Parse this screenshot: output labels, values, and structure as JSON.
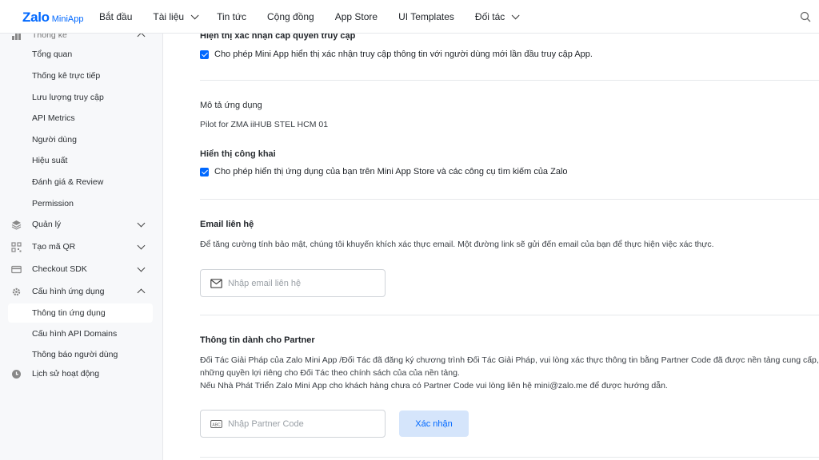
{
  "header": {
    "logo_main": "Zalo",
    "logo_sub": "MiniApp",
    "nav": [
      {
        "label": "Bắt đầu",
        "has_menu": false
      },
      {
        "label": "Tài liệu",
        "has_menu": true
      },
      {
        "label": "Tin tức",
        "has_menu": false
      },
      {
        "label": "Cộng đồng",
        "has_menu": false
      },
      {
        "label": "App Store",
        "has_menu": false
      },
      {
        "label": "UI Templates",
        "has_menu": false
      },
      {
        "label": "Đối tác",
        "has_menu": true
      }
    ],
    "search_icon": "search-icon"
  },
  "sidebar": {
    "cut_group": "Thống kê",
    "stats_items": [
      "Tổng quan",
      "Thống kê trực tiếp",
      "Lưu lượng truy cập",
      "API Metrics",
      "Người dùng",
      "Hiệu suất",
      "Đánh giá & Review",
      "Permission"
    ],
    "groups": [
      {
        "label": "Quản lý",
        "icon": "layers-icon"
      },
      {
        "label": "Tạo mã QR",
        "icon": "qr-code-icon"
      },
      {
        "label": "Checkout SDK",
        "icon": "credit-card-icon"
      },
      {
        "label": "Cấu hình ứng dụng",
        "icon": "gear-icon"
      }
    ],
    "config_items": [
      "Thông tin ứng dụng",
      "Cấu hình API Domains",
      "Thông báo người dùng"
    ],
    "active_item": "Thông tin ứng dụng",
    "history": {
      "label": "Lịch sử hoạt động",
      "icon": "clock-icon"
    }
  },
  "main": {
    "access_confirm": {
      "title": "Hiện thị xác nhận cấp quyền truy cập",
      "checkbox_label": "Cho phép Mini App hiển thị xác nhận truy cập thông tin với người dùng mới lần đầu truy cập App.",
      "checked": true
    },
    "description": {
      "label": "Mô tả ứng dụng",
      "value": "Pilot for ZMA iiHUB STEL HCM 01"
    },
    "public_display": {
      "label": "Hiển thị công khai",
      "checkbox_label": "Cho phép hiển thị ứng dụng của bạn trên Mini App Store và các công cụ tìm kiếm của Zalo",
      "checked": true
    },
    "email": {
      "title": "Email liên hệ",
      "description": "Để tăng cường tính bảo mật, chúng tôi khuyến khích xác thực email. Một đường link sẽ gửi đến email của bạn để thực hiện việc xác thực.",
      "placeholder": "Nhập email liên hệ",
      "icon": "mail-icon"
    },
    "partner": {
      "title": "Thông tin dành cho Partner",
      "line1": "Đối Tác Giải Pháp của Zalo Mini App /Đối Tác đã đăng ký chương trình Đối Tác Giải Pháp, vui lòng xác thực thông tin bằng Partner Code đã được nền tảng cung cấp, để",
      "line2": "những quyền lợi riêng cho Đối Tác theo chính sách của của nền tảng.",
      "line3": "Nếu Nhà Phát Triển Zalo Mini App cho khách hàng chưa có Partner Code vui lòng liên hệ mini@zalo.me để được hướng dẫn.",
      "placeholder": "Nhập Partner Code",
      "icon": "abc-icon",
      "confirm_label": "Xác nhận"
    }
  },
  "colors": {
    "accent": "#0068ff",
    "confirm_bg": "#d5e5fb",
    "sidebar_bg": "#f7f8fa"
  }
}
